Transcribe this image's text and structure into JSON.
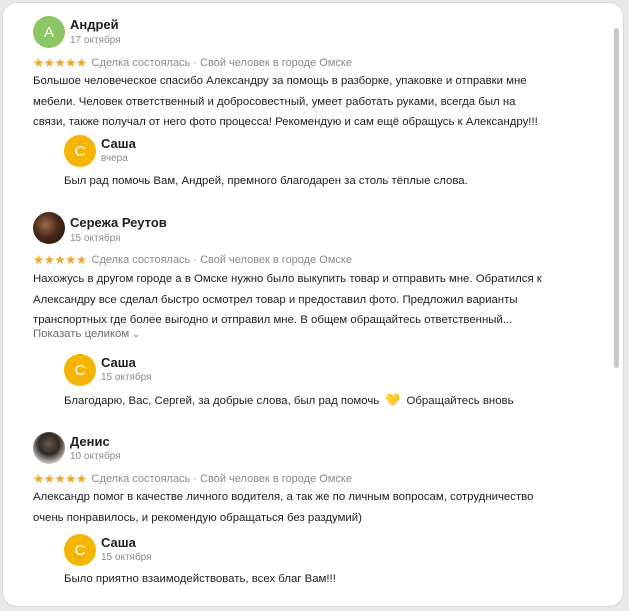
{
  "reviews": [
    {
      "author": "Андрей",
      "avatar_letter": "А",
      "date": "17 октября",
      "rating_stars": "★★★★★",
      "rating": 5,
      "tags": "Сделка состоялась · Свой человек в городе Омске",
      "lines": [
        "Большое человеческое спасибо Александру за помощь в разборке, упаковке и отправки мне",
        "мебели. Человек ответственный и добросовестный, умеет работать руками, всегда был на",
        "связи, также получал от него фото процесса! Рекомендую и сам ещё обращусь к Александру!!!"
      ],
      "reply": {
        "author": "Саша",
        "avatar_letter": "С",
        "date": "вчера",
        "text": "Был рад помочь Вам, Андрей, премного благодарен за столь тёплые слова."
      }
    },
    {
      "author": "Сережа Реутов",
      "date": "15 октября",
      "rating_stars": "★★★★★",
      "rating": 5,
      "tags": "Сделка состоялась · Свой человек в городе Омске",
      "lines": [
        "Нахожусь в другом городе а в Омске нужно было выкупить товар и отправить мне. Обратился к",
        "Александру все сделал быстро осмотрел товар и предоставил фото. Предложил варианты",
        "транспортных где более выгодно и отправил мне. В общем обращайтесь ответственный..."
      ],
      "show_more": "Показать целиком",
      "reply": {
        "author": "Саша",
        "avatar_letter": "С",
        "date": "15 октября",
        "text_before": "Благодарю, Вас, Сергей, за добрые слова, был рад помочь",
        "emoji": "💛",
        "text_after": "Обращайтесь вновь"
      }
    },
    {
      "author": "Денис",
      "date": "10 октября",
      "rating_stars": "★★★★★",
      "rating": 5,
      "tags": "Сделка состоялась · Свой человек в городе Омске",
      "lines": [
        "Александр помог в качестве личного водителя, а так же по личным вопросам, сотрудничество",
        "очень понравилось, и рекомендую обращаться без раздумий)"
      ],
      "reply": {
        "author": "Саша",
        "avatar_letter": "С",
        "date": "15 октября",
        "text": "Было приятно взаимодействовать, всех благ Вам!!!"
      }
    }
  ]
}
